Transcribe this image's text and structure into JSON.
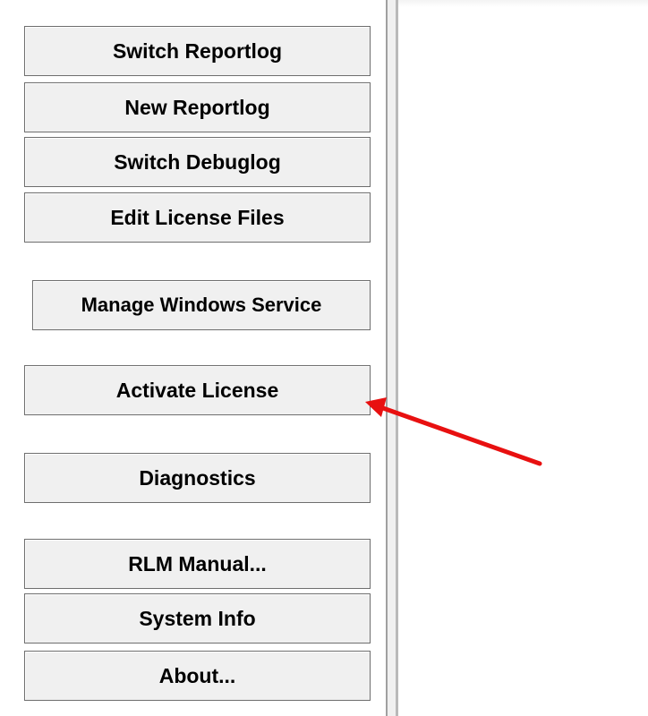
{
  "sidebar": {
    "buttons": {
      "switch_reportlog": "Switch Reportlog",
      "new_reportlog": "New Reportlog",
      "switch_debuglog": "Switch Debuglog",
      "edit_license_files": "Edit License Files",
      "manage_windows_service": "Manage Windows Service",
      "activate_license": "Activate License",
      "diagnostics": "Diagnostics",
      "rlm_manual": "RLM Manual...",
      "system_info": "System Info",
      "about": "About..."
    }
  },
  "annotation": {
    "arrow_color": "#e81010",
    "points_to": "Activate License"
  }
}
